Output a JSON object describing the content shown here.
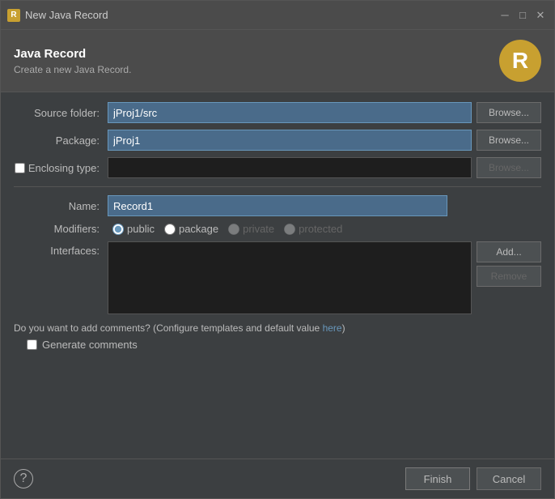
{
  "titleBar": {
    "icon": "R",
    "title": "New Java Record",
    "minimize": "─",
    "maximize": "□",
    "close": "✕"
  },
  "header": {
    "title": "Java Record",
    "subtitle": "Create a new Java Record.",
    "iconLetter": "R"
  },
  "form": {
    "sourceFolderLabel": "Source folder:",
    "sourceFolderValue": "jProj1/src",
    "sourceFolderBrowse": "Browse...",
    "packageLabel": "Package:",
    "packageValue": "jProj1",
    "packageBrowse": "Browse...",
    "enclosingTypeLabel": "Enclosing type:",
    "enclosingTypeBrowse": "Browse...",
    "nameLabel": "Name:",
    "nameValue": "Record1",
    "modifiersLabel": "Modifiers:",
    "modifiers": [
      {
        "id": "public",
        "label": "public",
        "checked": true,
        "disabled": false
      },
      {
        "id": "package",
        "label": "package",
        "checked": false,
        "disabled": false
      },
      {
        "id": "private",
        "label": "private",
        "checked": false,
        "disabled": true
      },
      {
        "id": "protected",
        "label": "protected",
        "checked": false,
        "disabled": true
      }
    ],
    "interfacesLabel": "Interfaces:",
    "interfacesAddBtn": "Add...",
    "interfacesRemoveBtn": "Remove"
  },
  "comments": {
    "question": "Do you want to add comments? (Configure templates and default value ",
    "linkText": "here",
    "questionEnd": ")",
    "generateLabel": "Generate comments"
  },
  "footer": {
    "helpSymbol": "?",
    "finishBtn": "Finish",
    "cancelBtn": "Cancel"
  }
}
